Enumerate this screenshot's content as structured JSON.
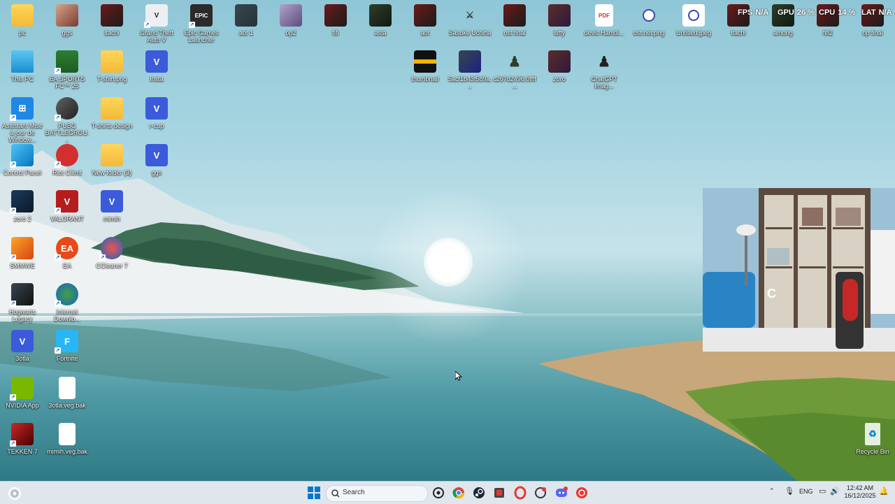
{
  "desktop": {
    "icons_col1": [
      {
        "label": "pc",
        "kind": "folder"
      },
      {
        "label": "This PC",
        "kind": "monitor"
      },
      {
        "label": "Assistant Mise à jour de Window...",
        "kind": "windows"
      },
      {
        "label": "Control Panel",
        "kind": "control"
      },
      {
        "label": "zoro 2",
        "kind": "avatar"
      },
      {
        "label": "SMMWE",
        "kind": "game"
      },
      {
        "label": "Hogwarts Legacy",
        "kind": "game-dark"
      },
      {
        "label": "3otla",
        "kind": "vapp"
      },
      {
        "label": "NVIDIA App",
        "kind": "nvidia"
      },
      {
        "label": "TEKKEN 7",
        "kind": "tekken"
      }
    ],
    "icons_col2": [
      {
        "label": "ggs",
        "kind": "avatar"
      },
      {
        "label": "EA SPORTS FC™ 25",
        "kind": "game"
      },
      {
        "label": "PUBG BATTLEGROU...",
        "kind": "pubg"
      },
      {
        "label": "Riot Client",
        "kind": "riot"
      },
      {
        "label": "VALORANT",
        "kind": "valorant"
      },
      {
        "label": "EA",
        "kind": "ea"
      },
      {
        "label": "Internet Downlo...",
        "kind": "idm"
      },
      {
        "label": "Fortnite",
        "kind": "fortnite"
      },
      {
        "label": "3otla.veg.bak",
        "kind": "doc"
      },
      {
        "label": "mimih.veg.bak",
        "kind": "doc"
      }
    ],
    "icons_col3": [
      {
        "label": "itachi",
        "kind": "avatar"
      },
      {
        "label": "T-shirt.png",
        "kind": "folder"
      },
      {
        "label": "T-shirts design",
        "kind": "folder"
      },
      {
        "label": "New folder (3)",
        "kind": "folder"
      },
      {
        "label": "mimih",
        "kind": "vapp"
      },
      {
        "label": "CCleaner 7",
        "kind": "ccleaner"
      }
    ],
    "icons_col4": [
      {
        "label": "Grand Theft Auto V",
        "kind": "gta"
      },
      {
        "label": "insta",
        "kind": "vapp"
      },
      {
        "label": "r-cup",
        "kind": "vapp"
      },
      {
        "label": "ggs",
        "kind": "vapp"
      }
    ],
    "icons_top_row": [
      {
        "label": "Epic Games Launcher",
        "kind": "epic"
      },
      {
        "label": "aot 1",
        "kind": "aot"
      },
      {
        "label": "op2",
        "kind": "anime"
      },
      {
        "label": "fifi",
        "kind": "avatar"
      },
      {
        "label": "asta",
        "kind": "avatar-green"
      },
      {
        "label": "aot",
        "kind": "avatar"
      },
      {
        "label": "Sasuke Uchiha",
        "kind": "figure"
      },
      {
        "label": "ost final",
        "kind": "avatar"
      },
      {
        "label": "luffy",
        "kind": "avatar-blue"
      },
      {
        "label": "devis Hamdi...",
        "kind": "pdf"
      },
      {
        "label": "ost.net.png",
        "kind": "image"
      },
      {
        "label": "Untitled.jpeg",
        "kind": "image"
      },
      {
        "label": "itachi",
        "kind": "avatar"
      },
      {
        "label": "among",
        "kind": "avatar-green"
      },
      {
        "label": "fifi2",
        "kind": "avatar"
      },
      {
        "label": "op final",
        "kind": "avatar"
      }
    ],
    "icons_second_row": [
      {
        "label": "thumbnail",
        "kind": "thumb"
      },
      {
        "label": "5acf1b43f5b9a...",
        "kind": "aot"
      },
      {
        "label": "c267d2496.0ffff...",
        "kind": "figure"
      },
      {
        "label": "zoro",
        "kind": "avatar"
      },
      {
        "label": "ChatGPT Imag...",
        "kind": "figure"
      }
    ],
    "recycle_bin": "Recycle Bin"
  },
  "overlay": {
    "fps_label": "FPS",
    "fps_value": "N/A",
    "gpu_label": "GPU",
    "gpu_value": "26 %",
    "cpu_label": "CPU",
    "cpu_value": "14 %",
    "lat_label": "LAT",
    "lat_value": "N/A"
  },
  "taskbar": {
    "search_placeholder": "Search",
    "apps": [
      "start-icon",
      "search-icon",
      "chatgpt-icon",
      "chrome-icon",
      "steam-icon",
      "snipping-tool-icon",
      "opera-icon",
      "app-icon",
      "discord-icon",
      "app-red-icon"
    ],
    "language": "ENG",
    "time": "12:42 AM",
    "date": "16/12/2025"
  },
  "colors": {
    "accent": "#0078d4",
    "taskbar_bg": "#dfe6ec"
  }
}
